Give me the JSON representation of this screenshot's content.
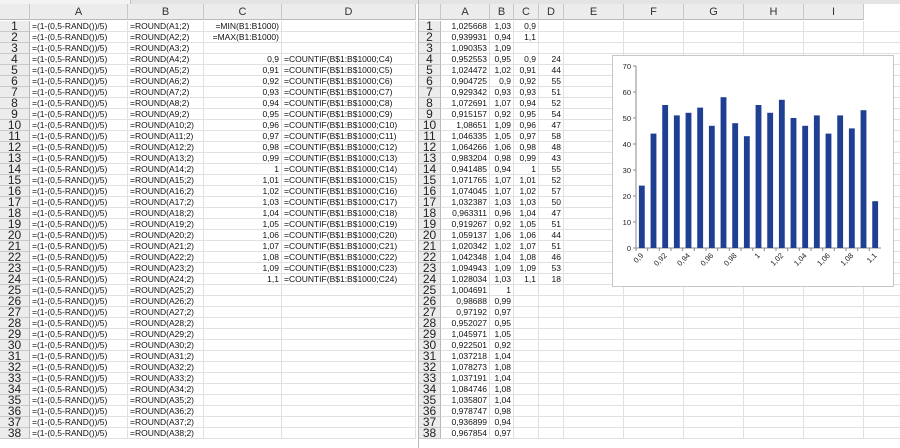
{
  "left": {
    "columns": [
      "A",
      "B",
      "C",
      "D"
    ],
    "rows": [
      {
        "n": "1",
        "a": "=(1-(0,5-RAND())/5)",
        "b": "=ROUND(A1;2)",
        "c": "=MIN(B1:B1000)",
        "d": ""
      },
      {
        "n": "2",
        "a": "=(1-(0,5-RAND())/5)",
        "b": "=ROUND(A2;2)",
        "c": "=MAX(B1:B1000)",
        "d": ""
      },
      {
        "n": "3",
        "a": "=(1-(0,5-RAND())/5)",
        "b": "=ROUND(A3;2)",
        "c": "",
        "d": ""
      },
      {
        "n": "4",
        "a": "=(1-(0,5-RAND())/5)",
        "b": "=ROUND(A4;2)",
        "c": "0,9",
        "d": "=COUNTIF(B$1:B$1000;C4)"
      },
      {
        "n": "5",
        "a": "=(1-(0,5-RAND())/5)",
        "b": "=ROUND(A5;2)",
        "c": "0,91",
        "d": "=COUNTIF(B$1:B$1000;C5)"
      },
      {
        "n": "6",
        "a": "=(1-(0,5-RAND())/5)",
        "b": "=ROUND(A6;2)",
        "c": "0,92",
        "d": "=COUNTIF(B$1:B$1000;C6)"
      },
      {
        "n": "7",
        "a": "=(1-(0,5-RAND())/5)",
        "b": "=ROUND(A7;2)",
        "c": "0,93",
        "d": "=COUNTIF(B$1:B$1000;C7)"
      },
      {
        "n": "8",
        "a": "=(1-(0,5-RAND())/5)",
        "b": "=ROUND(A8;2)",
        "c": "0,94",
        "d": "=COUNTIF(B$1:B$1000;C8)"
      },
      {
        "n": "9",
        "a": "=(1-(0,5-RAND())/5)",
        "b": "=ROUND(A9;2)",
        "c": "0,95",
        "d": "=COUNTIF(B$1:B$1000;C9)"
      },
      {
        "n": "10",
        "a": "=(1-(0,5-RAND())/5)",
        "b": "=ROUND(A10;2)",
        "c": "0,96",
        "d": "=COUNTIF(B$1:B$1000;C10)"
      },
      {
        "n": "11",
        "a": "=(1-(0,5-RAND())/5)",
        "b": "=ROUND(A11;2)",
        "c": "0,97",
        "d": "=COUNTIF(B$1:B$1000;C11)"
      },
      {
        "n": "12",
        "a": "=(1-(0,5-RAND())/5)",
        "b": "=ROUND(A12;2)",
        "c": "0,98",
        "d": "=COUNTIF(B$1:B$1000;C12)"
      },
      {
        "n": "13",
        "a": "=(1-(0,5-RAND())/5)",
        "b": "=ROUND(A13;2)",
        "c": "0,99",
        "d": "=COUNTIF(B$1:B$1000;C13)"
      },
      {
        "n": "14",
        "a": "=(1-(0,5-RAND())/5)",
        "b": "=ROUND(A14;2)",
        "c": "1",
        "d": "=COUNTIF(B$1:B$1000;C14)"
      },
      {
        "n": "15",
        "a": "=(1-(0,5-RAND())/5)",
        "b": "=ROUND(A15;2)",
        "c": "1,01",
        "d": "=COUNTIF(B$1:B$1000;C15)"
      },
      {
        "n": "16",
        "a": "=(1-(0,5-RAND())/5)",
        "b": "=ROUND(A16;2)",
        "c": "1,02",
        "d": "=COUNTIF(B$1:B$1000;C16)"
      },
      {
        "n": "17",
        "a": "=(1-(0,5-RAND())/5)",
        "b": "=ROUND(A17;2)",
        "c": "1,03",
        "d": "=COUNTIF(B$1:B$1000;C17)"
      },
      {
        "n": "18",
        "a": "=(1-(0,5-RAND())/5)",
        "b": "=ROUND(A18;2)",
        "c": "1,04",
        "d": "=COUNTIF(B$1:B$1000;C18)"
      },
      {
        "n": "19",
        "a": "=(1-(0,5-RAND())/5)",
        "b": "=ROUND(A19;2)",
        "c": "1,05",
        "d": "=COUNTIF(B$1:B$1000;C19)"
      },
      {
        "n": "20",
        "a": "=(1-(0,5-RAND())/5)",
        "b": "=ROUND(A20;2)",
        "c": "1,06",
        "d": "=COUNTIF(B$1:B$1000;C20)"
      },
      {
        "n": "21",
        "a": "=(1-(0,5-RAND())/5)",
        "b": "=ROUND(A21;2)",
        "c": "1,07",
        "d": "=COUNTIF(B$1:B$1000;C21)"
      },
      {
        "n": "22",
        "a": "=(1-(0,5-RAND())/5)",
        "b": "=ROUND(A22;2)",
        "c": "1,08",
        "d": "=COUNTIF(B$1:B$1000;C22)"
      },
      {
        "n": "23",
        "a": "=(1-(0,5-RAND())/5)",
        "b": "=ROUND(A23;2)",
        "c": "1,09",
        "d": "=COUNTIF(B$1:B$1000;C23)"
      },
      {
        "n": "24",
        "a": "=(1-(0,5-RAND())/5)",
        "b": "=ROUND(A24;2)",
        "c": "1,1",
        "d": "=COUNTIF(B$1:B$1000;C24)"
      },
      {
        "n": "25",
        "a": "=(1-(0,5-RAND())/5)",
        "b": "=ROUND(A25;2)",
        "c": "",
        "d": ""
      },
      {
        "n": "26",
        "a": "=(1-(0,5-RAND())/5)",
        "b": "=ROUND(A26;2)",
        "c": "",
        "d": ""
      },
      {
        "n": "27",
        "a": "=(1-(0,5-RAND())/5)",
        "b": "=ROUND(A27;2)",
        "c": "",
        "d": ""
      },
      {
        "n": "28",
        "a": "=(1-(0,5-RAND())/5)",
        "b": "=ROUND(A28;2)",
        "c": "",
        "d": ""
      },
      {
        "n": "29",
        "a": "=(1-(0,5-RAND())/5)",
        "b": "=ROUND(A29;2)",
        "c": "",
        "d": ""
      },
      {
        "n": "30",
        "a": "=(1-(0,5-RAND())/5)",
        "b": "=ROUND(A30;2)",
        "c": "",
        "d": ""
      },
      {
        "n": "31",
        "a": "=(1-(0,5-RAND())/5)",
        "b": "=ROUND(A31;2)",
        "c": "",
        "d": ""
      },
      {
        "n": "32",
        "a": "=(1-(0,5-RAND())/5)",
        "b": "=ROUND(A32;2)",
        "c": "",
        "d": ""
      },
      {
        "n": "33",
        "a": "=(1-(0,5-RAND())/5)",
        "b": "=ROUND(A33;2)",
        "c": "",
        "d": ""
      },
      {
        "n": "34",
        "a": "=(1-(0,5-RAND())/5)",
        "b": "=ROUND(A34;2)",
        "c": "",
        "d": ""
      },
      {
        "n": "35",
        "a": "=(1-(0,5-RAND())/5)",
        "b": "=ROUND(A35;2)",
        "c": "",
        "d": ""
      },
      {
        "n": "36",
        "a": "=(1-(0,5-RAND())/5)",
        "b": "=ROUND(A36;2)",
        "c": "",
        "d": ""
      },
      {
        "n": "37",
        "a": "=(1-(0,5-RAND())/5)",
        "b": "=ROUND(A37;2)",
        "c": "",
        "d": ""
      },
      {
        "n": "38",
        "a": "=(1-(0,5-RAND())/5)",
        "b": "=ROUND(A38;2)",
        "c": "",
        "d": ""
      }
    ]
  },
  "right": {
    "columns": [
      "A",
      "B",
      "C",
      "D",
      "E",
      "F",
      "G",
      "H",
      "I"
    ],
    "rows": [
      {
        "n": "1",
        "a": "1,025668",
        "b": "1,03",
        "c": "0,9",
        "d": ""
      },
      {
        "n": "2",
        "a": "0,939931",
        "b": "0,94",
        "c": "1,1",
        "d": ""
      },
      {
        "n": "3",
        "a": "1,090353",
        "b": "1,09",
        "c": "",
        "d": ""
      },
      {
        "n": "4",
        "a": "0,952553",
        "b": "0,95",
        "c": "0,9",
        "d": "24"
      },
      {
        "n": "5",
        "a": "1,024472",
        "b": "1,02",
        "c": "0,91",
        "d": "44"
      },
      {
        "n": "6",
        "a": "0,904725",
        "b": "0,9",
        "c": "0,92",
        "d": "55"
      },
      {
        "n": "7",
        "a": "0,929342",
        "b": "0,93",
        "c": "0,93",
        "d": "51"
      },
      {
        "n": "8",
        "a": "1,072691",
        "b": "1,07",
        "c": "0,94",
        "d": "52"
      },
      {
        "n": "9",
        "a": "0,915157",
        "b": "0,92",
        "c": "0,95",
        "d": "54"
      },
      {
        "n": "10",
        "a": "1,08651",
        "b": "1,09",
        "c": "0,96",
        "d": "47"
      },
      {
        "n": "11",
        "a": "1,046335",
        "b": "1,05",
        "c": "0,97",
        "d": "58"
      },
      {
        "n": "12",
        "a": "1,064266",
        "b": "1,06",
        "c": "0,98",
        "d": "48"
      },
      {
        "n": "13",
        "a": "0,983204",
        "b": "0,98",
        "c": "0,99",
        "d": "43"
      },
      {
        "n": "14",
        "a": "0,941485",
        "b": "0,94",
        "c": "1",
        "d": "55"
      },
      {
        "n": "15",
        "a": "1,071765",
        "b": "1,07",
        "c": "1,01",
        "d": "52"
      },
      {
        "n": "16",
        "a": "1,074045",
        "b": "1,07",
        "c": "1,02",
        "d": "57"
      },
      {
        "n": "17",
        "a": "1,032387",
        "b": "1,03",
        "c": "1,03",
        "d": "50"
      },
      {
        "n": "18",
        "a": "0,963311",
        "b": "0,96",
        "c": "1,04",
        "d": "47"
      },
      {
        "n": "19",
        "a": "0,919267",
        "b": "0,92",
        "c": "1,05",
        "d": "51"
      },
      {
        "n": "20",
        "a": "1,059137",
        "b": "1,06",
        "c": "1,06",
        "d": "44"
      },
      {
        "n": "21",
        "a": "1,020342",
        "b": "1,02",
        "c": "1,07",
        "d": "51"
      },
      {
        "n": "22",
        "a": "1,042348",
        "b": "1,04",
        "c": "1,08",
        "d": "46"
      },
      {
        "n": "23",
        "a": "1,094943",
        "b": "1,09",
        "c": "1,09",
        "d": "53"
      },
      {
        "n": "24",
        "a": "1,028034",
        "b": "1,03",
        "c": "1,1",
        "d": "18"
      },
      {
        "n": "25",
        "a": "1,004691",
        "b": "1",
        "c": "",
        "d": ""
      },
      {
        "n": "26",
        "a": "0,98688",
        "b": "0,99",
        "c": "",
        "d": ""
      },
      {
        "n": "27",
        "a": "0,97192",
        "b": "0,97",
        "c": "",
        "d": ""
      },
      {
        "n": "28",
        "a": "0,952027",
        "b": "0,95",
        "c": "",
        "d": ""
      },
      {
        "n": "29",
        "a": "1,045971",
        "b": "1,05",
        "c": "",
        "d": ""
      },
      {
        "n": "30",
        "a": "0,922501",
        "b": "0,92",
        "c": "",
        "d": ""
      },
      {
        "n": "31",
        "a": "1,037218",
        "b": "1,04",
        "c": "",
        "d": ""
      },
      {
        "n": "32",
        "a": "1,078273",
        "b": "1,08",
        "c": "",
        "d": ""
      },
      {
        "n": "33",
        "a": "1,037191",
        "b": "1,04",
        "c": "",
        "d": ""
      },
      {
        "n": "34",
        "a": "1,084746",
        "b": "1,08",
        "c": "",
        "d": ""
      },
      {
        "n": "35",
        "a": "1,035807",
        "b": "1,04",
        "c": "",
        "d": ""
      },
      {
        "n": "36",
        "a": "0,978747",
        "b": "0,98",
        "c": "",
        "d": ""
      },
      {
        "n": "37",
        "a": "0,936899",
        "b": "0,94",
        "c": "",
        "d": ""
      },
      {
        "n": "38",
        "a": "0,967854",
        "b": "0,97",
        "c": "",
        "d": ""
      }
    ]
  },
  "chart_data": {
    "type": "bar",
    "categories": [
      "0,9",
      "0,91",
      "0,92",
      "0,93",
      "0,94",
      "0,95",
      "0,96",
      "0,97",
      "0,98",
      "0,99",
      "1",
      "1,01",
      "1,02",
      "1,03",
      "1,04",
      "1,05",
      "1,06",
      "1,07",
      "1,08",
      "1,09",
      "1,1"
    ],
    "values": [
      24,
      44,
      55,
      51,
      52,
      54,
      47,
      58,
      48,
      43,
      55,
      52,
      57,
      50,
      47,
      51,
      44,
      51,
      46,
      53,
      18
    ],
    "tick_labels": [
      "0,9",
      "0,92",
      "0,94",
      "0,96",
      "0,98",
      "1",
      "1,02",
      "1,04",
      "1,06",
      "1,08",
      "1,1"
    ],
    "yticks": [
      "0",
      "10",
      "20",
      "30",
      "40",
      "50",
      "60",
      "70"
    ],
    "ylim": [
      0,
      70
    ],
    "bar_color": "#1f3f93",
    "title": "",
    "xlabel": "",
    "ylabel": ""
  }
}
